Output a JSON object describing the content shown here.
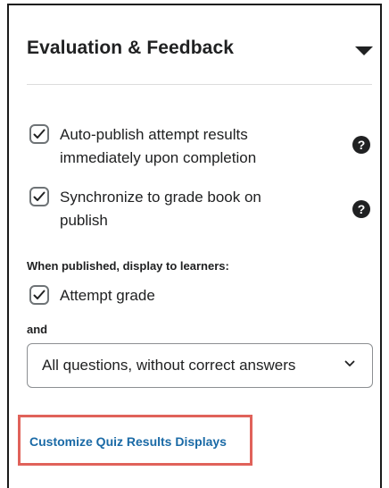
{
  "section": {
    "title": "Evaluation & Feedback",
    "toggle_icon": "caret-down-icon"
  },
  "options": [
    {
      "label_line1": "Auto-publish attempt results",
      "label_line2": "immediately upon completion",
      "checked": true,
      "help_icon": "question-circle-icon"
    },
    {
      "label_line1": "Synchronize to grade book on",
      "label_line2": "publish",
      "checked": true,
      "help_icon": "question-circle-icon"
    }
  ],
  "display": {
    "heading": "When published, display to learners:",
    "attempt_grade_label": "Attempt grade",
    "attempt_grade_checked": true,
    "and_label": "and",
    "select_value": "All questions, without correct answers"
  },
  "link": {
    "label": "Customize Quiz Results Displays",
    "highlight_color": "#e0625a",
    "color": "#1a6aa6"
  }
}
